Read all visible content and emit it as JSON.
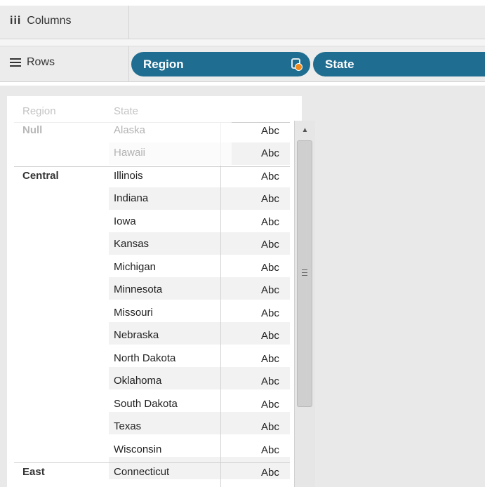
{
  "shelves": {
    "columns_label": "Columns",
    "rows_label": "Rows",
    "cols_icon": "iii"
  },
  "pills": {
    "region": "Region",
    "state": "State"
  },
  "table": {
    "headers": {
      "region": "Region",
      "state": "State"
    },
    "regions": {
      "null": "Null",
      "central": "Central",
      "east": "East"
    },
    "rows": [
      {
        "state": "Alaska",
        "value": "Abc"
      },
      {
        "state": "Hawaii",
        "value": "Abc"
      },
      {
        "state": "Illinois",
        "value": "Abc"
      },
      {
        "state": "Indiana",
        "value": "Abc"
      },
      {
        "state": "Iowa",
        "value": "Abc"
      },
      {
        "state": "Kansas",
        "value": "Abc"
      },
      {
        "state": "Michigan",
        "value": "Abc"
      },
      {
        "state": "Minnesota",
        "value": "Abc"
      },
      {
        "state": "Missouri",
        "value": "Abc"
      },
      {
        "state": "Nebraska",
        "value": "Abc"
      },
      {
        "state": "North Dakota",
        "value": "Abc"
      },
      {
        "state": "Oklahoma",
        "value": "Abc"
      },
      {
        "state": "South Dakota",
        "value": "Abc"
      },
      {
        "state": "Texas",
        "value": "Abc"
      },
      {
        "state": "Wisconsin",
        "value": "Abc"
      },
      {
        "state": "Connecticut",
        "value": "Abc"
      }
    ]
  },
  "colors": {
    "pill": "#1f6e91",
    "badge": "#f08a1c"
  },
  "icons": {
    "columns": "columns-icon",
    "rows": "rows-icon",
    "badge": "data-source-icon",
    "scroll_up": "arrow-up-icon",
    "scroll_grip": "scroll-grip-icon"
  }
}
